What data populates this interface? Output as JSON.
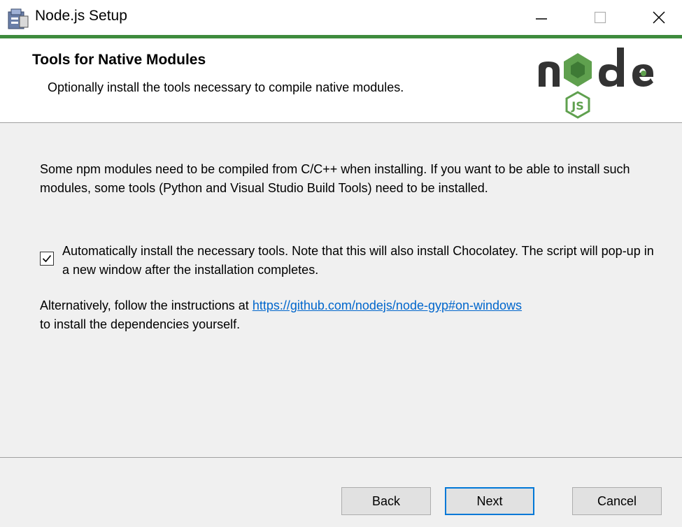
{
  "window": {
    "title": "Node.js Setup"
  },
  "header": {
    "title": "Tools for Native Modules",
    "subtitle": "Optionally install the tools necessary to compile native modules."
  },
  "content": {
    "description": "Some npm modules need to be compiled from C/C++ when installing. If you want to be able to install such modules, some tools (Python and Visual Studio Build Tools) need to be installed.",
    "checkbox": {
      "checked": true,
      "label": "Automatically install the necessary tools. Note that this will also install Chocolatey. The script will pop-up in a new window after the installation completes."
    },
    "alternative": {
      "prefix": "Alternatively, follow the instructions at ",
      "link": "https://github.com/nodejs/node-gyp#on-windows",
      "suffix": "to install the dependencies yourself."
    }
  },
  "footer": {
    "back_label": "Back",
    "next_label": "Next",
    "cancel_label": "Cancel"
  },
  "colors": {
    "accent_green": "#3e8b3d",
    "link_blue": "#0066cc",
    "focus_blue": "#0078d7",
    "panel_bg": "#f0f0f0"
  },
  "icons": {
    "app": "installer-icon",
    "minimize": "minimize-icon",
    "maximize": "maximize-icon",
    "close": "close-icon",
    "logo": "nodejs-logo",
    "check": "checkmark-icon"
  }
}
